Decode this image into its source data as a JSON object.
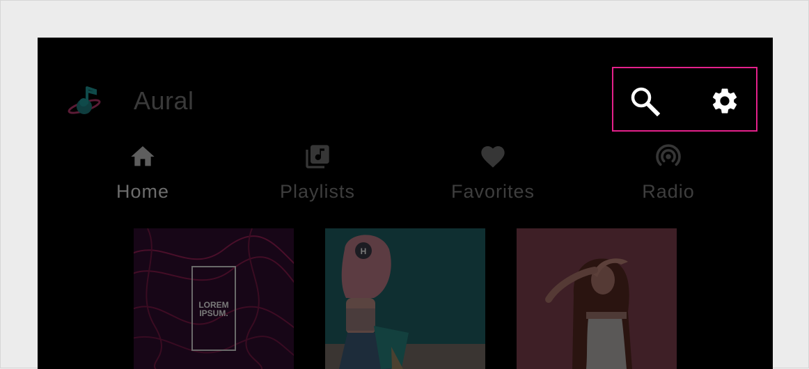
{
  "app": {
    "title": "Aural"
  },
  "toolbar": {
    "search_icon": "search-icon",
    "settings_icon": "gear-icon",
    "highlight_color": "#e5218b"
  },
  "tabs": [
    {
      "label": "Home",
      "icon": "home-icon",
      "active": true
    },
    {
      "label": "Playlists",
      "icon": "playlist-icon",
      "active": false
    },
    {
      "label": "Favorites",
      "icon": "heart-icon",
      "active": false
    },
    {
      "label": "Radio",
      "icon": "radio-icon",
      "active": false
    }
  ],
  "cards": [
    {
      "type": "album-art",
      "text": "LOREM IPSUM."
    },
    {
      "type": "photo",
      "badge": "H"
    },
    {
      "type": "photo"
    }
  ]
}
